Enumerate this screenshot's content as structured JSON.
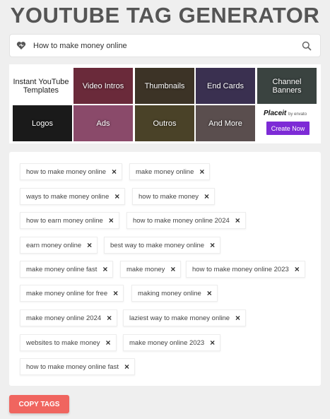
{
  "header": {
    "title": "YOUTUBE TAG GENERATOR"
  },
  "search": {
    "value": "How to make money online",
    "heart_icon": "heart-icon",
    "search_icon": "search-icon"
  },
  "templates": {
    "lead_label": "Instant YouTube Templates",
    "tiles": [
      {
        "label": "Video Intros",
        "color": "#6a2a3a"
      },
      {
        "label": "Thumbnails",
        "color": "#3c3326"
      },
      {
        "label": "End Cards",
        "color": "#3a3050"
      },
      {
        "label": "Channel Banners",
        "color": "#3a4340"
      },
      {
        "label": "Logos",
        "color": "#1a1a1a"
      },
      {
        "label": "Ads",
        "color": "#8a4a6a"
      },
      {
        "label": "Outros",
        "color": "#4a4228"
      },
      {
        "label": "And More",
        "color": "#5a4e4e"
      }
    ],
    "placeit": {
      "brand": "Placeit",
      "by": "by envato",
      "button": "Create Now",
      "accent": "#7d2bd6"
    }
  },
  "tags": [
    "how to make money online",
    "make money online",
    "ways to make money online",
    "how to make money",
    "how to earn money online",
    "how to make money online 2024",
    "earn money online",
    "best way to make money online",
    "make money online fast",
    "make money",
    "how to make money online 2023",
    "make money online for free",
    "making money online",
    "make money online 2024",
    "laziest way to make money online",
    "websites to make money",
    "make money online 2023",
    "how to make money online fast"
  ],
  "remove_icon": "×",
  "copy_button": {
    "label": "COPY TAGS",
    "color": "#f0655f"
  }
}
